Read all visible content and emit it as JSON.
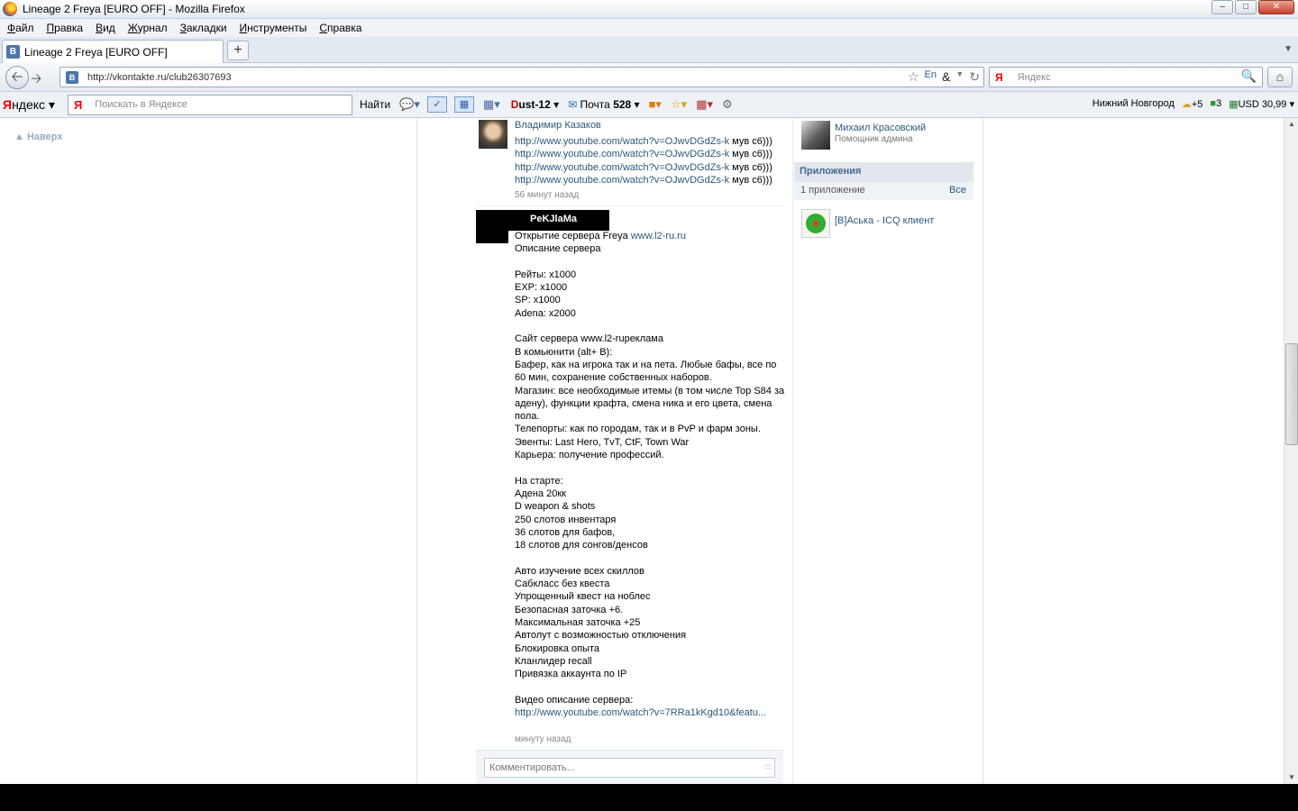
{
  "window": {
    "title": "Lineage 2 Freya [EURO OFF] - Mozilla Firefox"
  },
  "menu": [
    {
      "first": "Ф",
      "rest": "айл"
    },
    {
      "first": "П",
      "rest": "равка"
    },
    {
      "first": "В",
      "rest": "ид"
    },
    {
      "first": "Ж",
      "rest": "урнал"
    },
    {
      "first": "З",
      "rest": "акладки"
    },
    {
      "first": "И",
      "rest": "нструменты"
    },
    {
      "first": "С",
      "rest": "правка"
    }
  ],
  "tab": {
    "label": "Lineage 2 Freya [EURO OFF]",
    "favicon": "B"
  },
  "nav": {
    "url": "http://vkontakte.ru/club26307693",
    "search_placeholder": "Яндекс",
    "search_engine_icon": "Я"
  },
  "yabar": {
    "logo_first": "Я",
    "logo_rest": "ндекс",
    "search_placeholder": "Поискать в Яндексе",
    "find_label": "Найти",
    "dust_prefix": "D",
    "dust_rest": "ust-12",
    "mail_label": "Почта",
    "mail_count": "528",
    "city": "Нижний Новгород",
    "weather": "+5",
    "traffic": "3",
    "currency": "USD 30,99"
  },
  "left": {
    "up_link": "Наверх"
  },
  "post1": {
    "author": "Владимир Казаков",
    "lines": [
      {
        "link": "http://www.youtube.com/watch?v=OJwvDGdZs-k",
        "suffix": " мув с6)))"
      },
      {
        "link": "http://www.youtube.com/watch?v=OJwvDGdZs-k",
        "suffix": " мув с6)))"
      },
      {
        "link": "http://www.youtube.com/watch?v=OJwvDGdZs-k",
        "suffix": " мув с6)))"
      },
      {
        "link": "http://www.youtube.com/watch?v=OJwvDGdZs-k",
        "suffix": " мув с6)))"
      }
    ],
    "time": "56 минут назад"
  },
  "post2": {
    "banner": "PeKJlaMa",
    "intro": "Открытие сервера Freya ",
    "intro_link": "www.l2-ru.ru",
    "body": "\nОписание сервера\n\nРейты: x1000\nEXP: x1000\nSP: x1000\nAdena: x2000\n\nСайт сервера www.l2-rupeклама\nВ комьюнити (alt+ B):\nБафер, как на игрока так и на пета. Любые бафы, все по 60 мин, сохранение собственных наборов.\nМагазин: все необходимые итемы (в том числе Top S84 за адену), функции крафта, смена ника и его цвета, смена пола.\nТелепорты: как по городам, так и в PvP и фарм зоны.\nЭвенты: Last Hero, TvT, CtF, Town War\nКарьера: получение профессий.\n\nНа старте:\nАдена 20кк\nD weapon & shots\n250 слотов инвентаря\n36 слотов для бафов,\n18 слотов для сонгов/денсов\n\nАвто изучение всех скиллов\nСабкласс без квеста\nУпрощенный квест на ноблес\nБезопасная заточка +6.\nМаксимальная заточка +25\nАвтолут с возможностью отключения\nБлокировка опыта\nКланлидер recall\nПривязка аккаунта по IP\n\nВидео описание сервера:",
    "video_link": "http://www.youtube.com/watch?v=7RRa1kKgd10&featu...",
    "time": "минуту назад",
    "comment_placeholder": "Комментировать..."
  },
  "sidebar": {
    "admin_name": "Михаил Красовский",
    "admin_role": "Помощник админа",
    "apps_title": "Приложения",
    "apps_count": "1 приложение",
    "apps_all": "Все",
    "app_name": "[B]Аська - ICQ клиент"
  }
}
